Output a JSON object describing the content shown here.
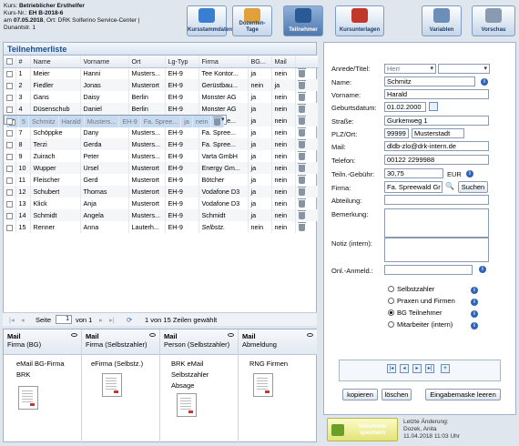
{
  "course_info": {
    "line1_label": "Kurs:",
    "line1_value": "Betrieblicher Ersthelfer",
    "line2_label": "Kurs-Nr.:",
    "line2_value": "EH B-2018-6",
    "line3_label": "am",
    "line3_date": "07.05.2018",
    "line3_rest": ", Ort: DRK Solferino Service-Center |",
    "line4": "Dunantstr. 1"
  },
  "toolbar": {
    "buttons": [
      {
        "label": "Kursstammdaten",
        "icon": "calendar-icon"
      },
      {
        "label": "Dozenten- Tage",
        "icon": "teacher-icon"
      },
      {
        "label": "Teilnehmer",
        "icon": "participants-icon"
      },
      {
        "label": "Kursunterlagen",
        "icon": "books-icon"
      },
      {
        "label": "Variablen",
        "icon": "variables-icon"
      },
      {
        "label": "Vorschau",
        "icon": "preview-icon"
      }
    ]
  },
  "list": {
    "title": "Teilnehmerliste",
    "columns": [
      "",
      "#",
      "Name",
      "Vorname",
      "Ort",
      "Lg-Typ",
      "Firma",
      "BG...",
      "Mail",
      ""
    ],
    "rows": [
      [
        "1",
        "Meier",
        "Hanni",
        "Musters...",
        "EH-9",
        "Tee Kontor...",
        "ja",
        "nein"
      ],
      [
        "2",
        "Fiedler",
        "Jonas",
        "Musterort",
        "EH-9",
        "Gerüstbau...",
        "nein",
        "ja"
      ],
      [
        "3",
        "Gans",
        "Daisy",
        "Berlin",
        "EH-9",
        "Monster AG",
        "ja",
        "nein"
      ],
      [
        "4",
        "Düsenschub",
        "Daniel",
        "Berlin",
        "EH-9",
        "Monster AG",
        "ja",
        "nein"
      ],
      [
        "5",
        "Schmitz",
        "Harald",
        "Musters...",
        "EH-9",
        "Fa. Spree...",
        "ja",
        "nein"
      ],
      [
        "6",
        "Deister",
        "Clara",
        "Musters...",
        "EH-9",
        "Fa. Spree...",
        "ja",
        "nein"
      ],
      [
        "7",
        "Schöppke",
        "Dany",
        "Musters...",
        "EH-9",
        "Fa. Spree...",
        "ja",
        "nein"
      ],
      [
        "8",
        "Terzi",
        "Gerda",
        "Musters...",
        "EH-9",
        "Fa. Spree...",
        "ja",
        "nein"
      ],
      [
        "9",
        "Zuirach",
        "Peter",
        "Musters...",
        "EH-9",
        "Varta GmbH",
        "ja",
        "nein"
      ],
      [
        "10",
        "Wupper",
        "Ursel",
        "Musterort",
        "EH-9",
        "Energy Gm...",
        "ja",
        "nein"
      ],
      [
        "11",
        "Fleischer",
        "Gerd",
        "Musterort",
        "EH-9",
        "Bötcher",
        "ja",
        "nein"
      ],
      [
        "12",
        "Schubert",
        "Thomas",
        "Musterort",
        "EH-9",
        "Vodafone D3",
        "ja",
        "nein"
      ],
      [
        "13",
        "Klick",
        "Anja",
        "Musterort",
        "EH-9",
        "Vodafone D3",
        "ja",
        "nein"
      ],
      [
        "14",
        "Schmidt",
        "Angela",
        "Musters...",
        "EH-9",
        "Schmidt",
        "ja",
        "nein"
      ],
      [
        "15",
        "Renner",
        "Anna",
        "Lauterh...",
        "EH-9",
        "Selbstz.",
        "nein",
        "nein"
      ]
    ],
    "selected_row": 4,
    "checked_row": 4,
    "pager": {
      "page_label": "Seite",
      "page_value": "1",
      "of_label": "von 1",
      "summary": "1 von 15 Zeilen gewählt"
    }
  },
  "mail": [
    {
      "title": "Mail",
      "subtitle": "Firma (BG)",
      "items": [
        "eMail BG-Firma",
        "BRK"
      ]
    },
    {
      "title": "Mail",
      "subtitle": "Firma (Selbstzahler)",
      "items": [
        "eFirma (Selbstz.)"
      ]
    },
    {
      "title": "Mail",
      "subtitle": "Person (Selbstzahler)",
      "items": [
        "BRK eMail",
        "Selbstzahler",
        "Absage"
      ]
    },
    {
      "title": "Mail",
      "subtitle": "Abmeldung",
      "items": [
        "RNG Firmen"
      ]
    }
  ],
  "form": {
    "anrede_label": "Anrede/Titel:",
    "anrede_value": "Herr",
    "name_label": "Name:",
    "name_value": "Schmitz",
    "vorname_label": "Vorname:",
    "vorname_value": "Harald",
    "geburt_label": "Geburtsdatum:",
    "geburt_value": "01.02.2000",
    "strasse_label": "Straße:",
    "strasse_value": "Gurkenweg 1",
    "plz_label": "PLZ/Ort:",
    "plz_value": "99999",
    "ort_value": "Musterstadt",
    "mail_label": "Mail:",
    "mail_value": "dldb-zlo@drk-intern.de",
    "telefon_label": "Telefon:",
    "telefon_value": "00122 2299988",
    "gebuehr_label": "Teiln.-Gebühr:",
    "gebuehr_value": "30,75",
    "gebuehr_unit": "EUR",
    "firma_label": "Firma:",
    "firma_value": "Fa. Spreewald Gr",
    "firma_search": "Suchen",
    "abteilung_label": "Abteilung:",
    "bemerkung_label": "Bemerkung:",
    "notiz_label": "Notiz (intern):",
    "onl_label": "Onl.-Anmeld.:",
    "options": [
      "Selbstzahler",
      "Praxen und Firmen",
      "BG Teilnehmer",
      "Mitarbeiter (intern)"
    ],
    "selected_option": 2,
    "btn_copy": "kopieren",
    "btn_delete": "löschen",
    "btn_clear": "Eingabemaske leeren"
  },
  "footer": {
    "save_label": "Teilnehmer speichern",
    "change_label": "Letzte Änderung:",
    "change_user": "Dozek, Anita",
    "change_date": "11.04.2018 11:03 Uhr"
  }
}
